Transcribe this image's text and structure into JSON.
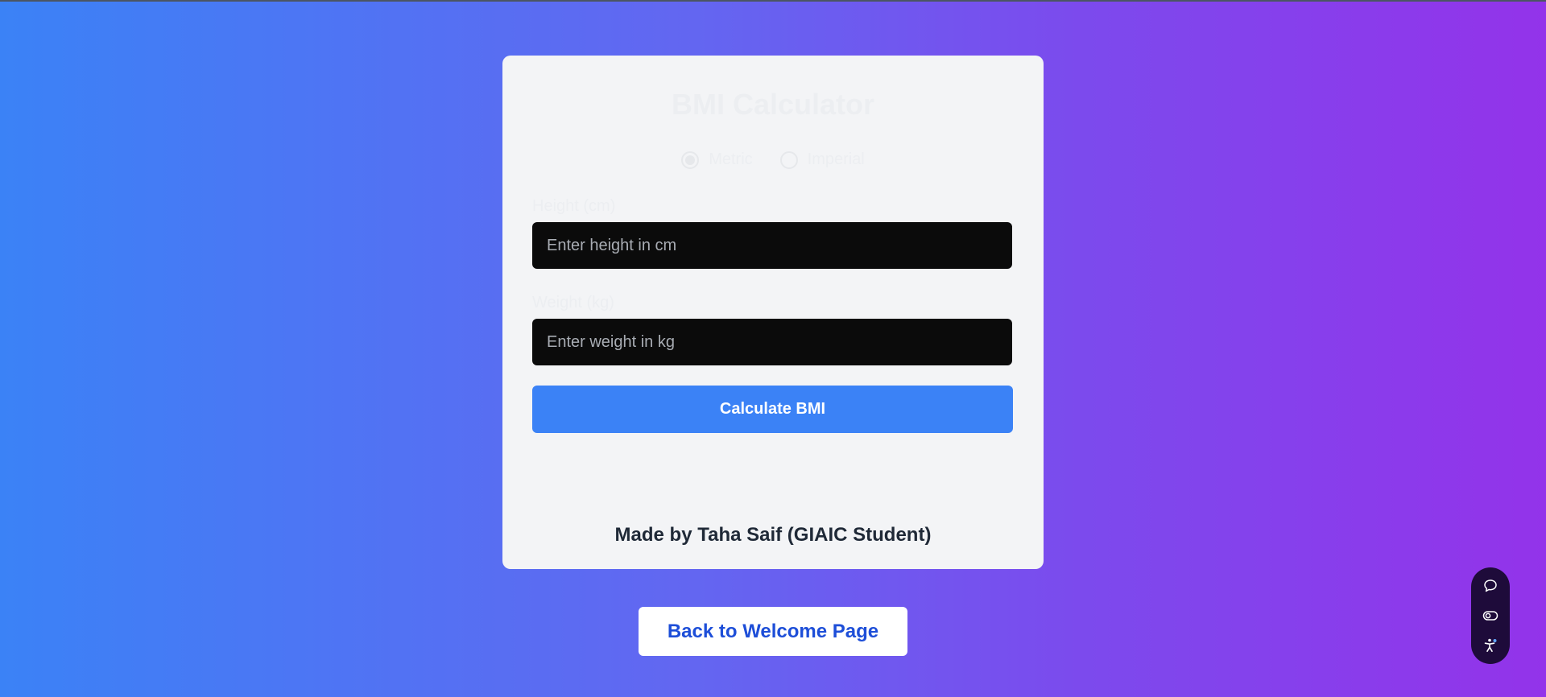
{
  "card": {
    "title": "BMI Calculator",
    "units": [
      {
        "label": "Metric",
        "selected": true
      },
      {
        "label": "Imperial",
        "selected": false
      }
    ],
    "height": {
      "label": "Height (cm)",
      "placeholder": "Enter height in cm",
      "value": ""
    },
    "weight": {
      "label": "Weight (kg)",
      "placeholder": "Enter weight in kg",
      "value": ""
    },
    "calculate_label": "Calculate BMI",
    "credit": "Made by Taha Saif (GIAIC Student)"
  },
  "back_button_label": "Back to Welcome Page",
  "widget": {
    "icons": [
      "chat-icon",
      "toggle-icon",
      "accessibility-icon"
    ]
  },
  "colors": {
    "background_start": "#3b82f6",
    "background_end": "#9333ea",
    "card": "#f3f4f6",
    "input": "#0b0b0b",
    "primary": "#3b82f6",
    "back_button_text": "#1d4ed8",
    "widget": "#1e0b3a"
  }
}
